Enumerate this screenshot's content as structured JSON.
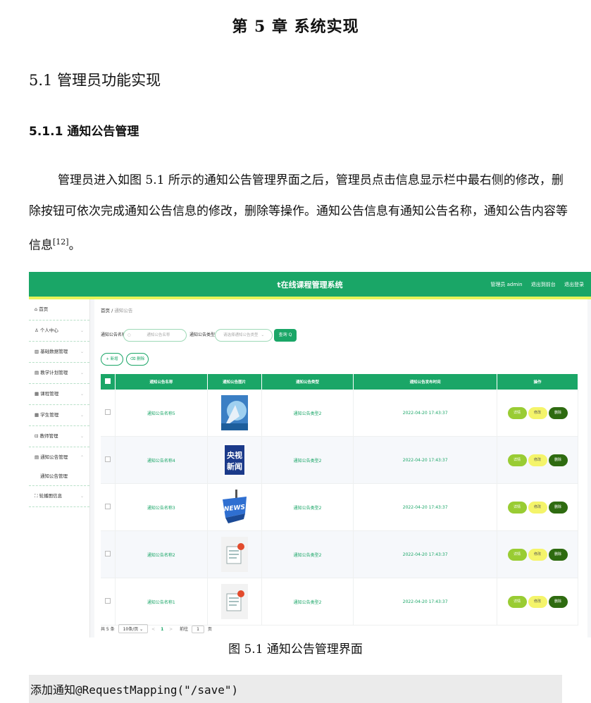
{
  "chapter_title": "第 5 章  系统实现",
  "section_title": "5.1 管理员功能实现",
  "subsection_title": "5.1.1  通知公告管理",
  "paragraph": "管理员进入如图 5.1 所示的通知公告管理界面之后，管理员点击信息显示栏中最右侧的修改，删除按钮可依次完成通知公告信息的修改，删除等操作。通知公告信息有通知公告名称，通知公告内容等信息",
  "paragraph_ref": "[12]",
  "paragraph_end": "。",
  "figure": {
    "app_title": "t在线课程管理系统",
    "header_links": [
      "管理员 admin",
      "退出到前台",
      "退出登录"
    ],
    "sidebar": {
      "items": [
        "首页",
        "个人中心",
        "基础数据管理",
        "教学计划管理",
        "课程管理",
        "学生管理",
        "教师管理",
        "通知公告管理",
        "轮播图信息"
      ],
      "submenu_item": "通知公告管理"
    },
    "breadcrumb": {
      "home": "首页",
      "sep": "/",
      "current": "通知公告"
    },
    "filters": {
      "name_label": "通知公告名称",
      "name_placeholder": "通知公告名称",
      "type_label": "通知公告类型",
      "type_placeholder": "请选择通知公告类型",
      "query_button": "查询 Q"
    },
    "actions": {
      "add": "+ 新增",
      "delete": "删除"
    },
    "table": {
      "headers": [
        "通知公告名称",
        "通知公告图片",
        "通知公告类型",
        "通知公告发布时间",
        "操作"
      ],
      "rows": [
        {
          "name": "通知公告名称5",
          "type": "通知公告类型2",
          "time": "2022-04-20 17:43:37",
          "image": "blue-abstract-image"
        },
        {
          "name": "通知公告名称4",
          "type": "通知公告类型2",
          "time": "2022-04-20 17:43:37",
          "image": "cctv-news-logo",
          "image_text": "央视新闻"
        },
        {
          "name": "通知公告名称3",
          "type": "通知公告类型2",
          "time": "2022-04-20 17:43:37",
          "image": "news-sign-image",
          "image_text": "NEWS"
        },
        {
          "name": "通知公告名称2",
          "type": "通知公告类型2",
          "time": "2022-04-20 17:43:37",
          "image": "document-icon-image"
        },
        {
          "name": "通知公告名称1",
          "type": "通知公告类型2",
          "time": "2022-04-20 17:43:37",
          "image": "document-icon-image"
        }
      ],
      "row_buttons": {
        "detail": "详情",
        "edit": "修改",
        "delete": "删除"
      }
    },
    "pager": {
      "total": "共 5 条",
      "page_size": "10条/页",
      "prev": "<",
      "current_page": "1",
      "next": ">",
      "goto_label": "前往",
      "goto_value": "1",
      "page_unit": "页"
    },
    "colors": {
      "primary": "#1aa667",
      "accent_yellow": "#e8f35a",
      "detail_btn": "#99cc33",
      "edit_btn": "#f4f46a",
      "delete_btn": "#2e6b10"
    }
  },
  "figure_caption": "图 5.1  通知公告管理界面",
  "code_line": "添加通知@RequestMapping(\"/save\")"
}
